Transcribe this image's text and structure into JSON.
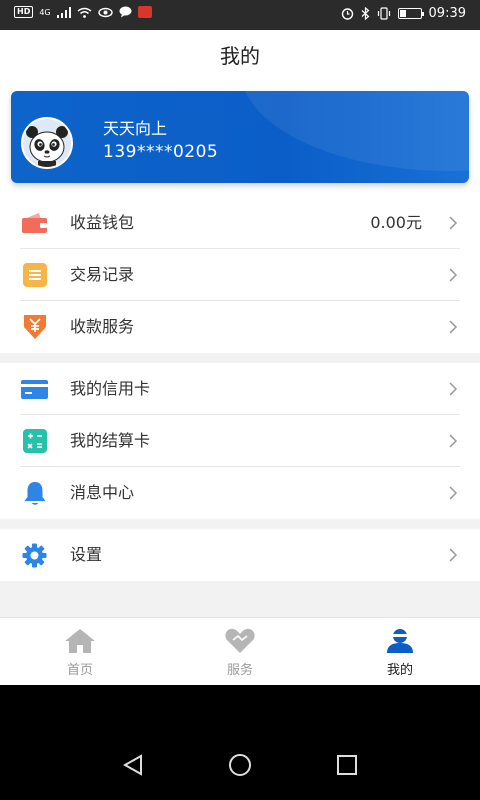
{
  "status_bar": {
    "left_badge": "HD",
    "network": "4G",
    "time": "09:39",
    "battery_level_percent": 30
  },
  "header": {
    "title": "我的"
  },
  "profile": {
    "name": "天天向上",
    "phone": "139****0205",
    "card_color": "#0b5ec8"
  },
  "menu": {
    "section1": [
      {
        "label": "收益钱包",
        "value": "0.00元",
        "icon": "wallet-icon",
        "color": "#f26b5b"
      },
      {
        "label": "交易记录",
        "icon": "record-icon",
        "color": "#f7b548"
      },
      {
        "label": "收款服务",
        "icon": "yuan-download-icon",
        "color": "#f37a33"
      }
    ],
    "section2": [
      {
        "label": "我的信用卡",
        "icon": "credit-card-icon",
        "color": "#2d86e6"
      },
      {
        "label": "我的结算卡",
        "icon": "calculator-icon",
        "color": "#26c1ab"
      },
      {
        "label": "消息中心",
        "icon": "bell-icon",
        "color": "#2d86e6"
      }
    ],
    "section3": [
      {
        "label": "设置",
        "icon": "gear-icon",
        "color": "#2d86e6"
      }
    ]
  },
  "tabs": [
    {
      "label": "首页",
      "icon": "home-icon",
      "active": false
    },
    {
      "label": "服务",
      "icon": "heart-icon",
      "active": false
    },
    {
      "label": "我的",
      "icon": "user-icon",
      "active": true
    }
  ],
  "colors": {
    "accent": "#0b5ec8",
    "inactive_tab": "#9a9a9a"
  }
}
